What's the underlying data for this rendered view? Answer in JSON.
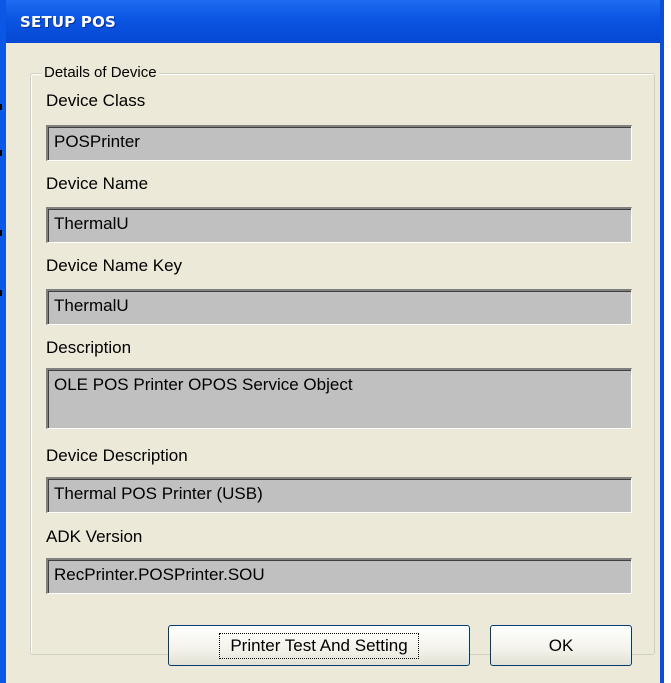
{
  "window": {
    "title": "SETUP POS"
  },
  "group": {
    "legend": "Details of Device"
  },
  "fields": [
    {
      "label": "Device Class",
      "value": "POSPrinter"
    },
    {
      "label": "Device Name",
      "value": "ThermalU"
    },
    {
      "label": "Device Name Key",
      "value": "ThermalU"
    },
    {
      "label": "Description",
      "value": "OLE POS Printer OPOS Service Object"
    },
    {
      "label": "Device Description",
      "value": "Thermal POS Printer (USB)"
    },
    {
      "label": "ADK Version",
      "value": "RecPrinter.POSPrinter.SOU"
    }
  ],
  "buttons": {
    "printer_test_label": "Printer Test And Setting",
    "ok_label": "OK"
  },
  "colors": {
    "titlebar": "#0a55e3",
    "dialog_face": "#ece9d8",
    "field_background": "#c0c0c0"
  }
}
